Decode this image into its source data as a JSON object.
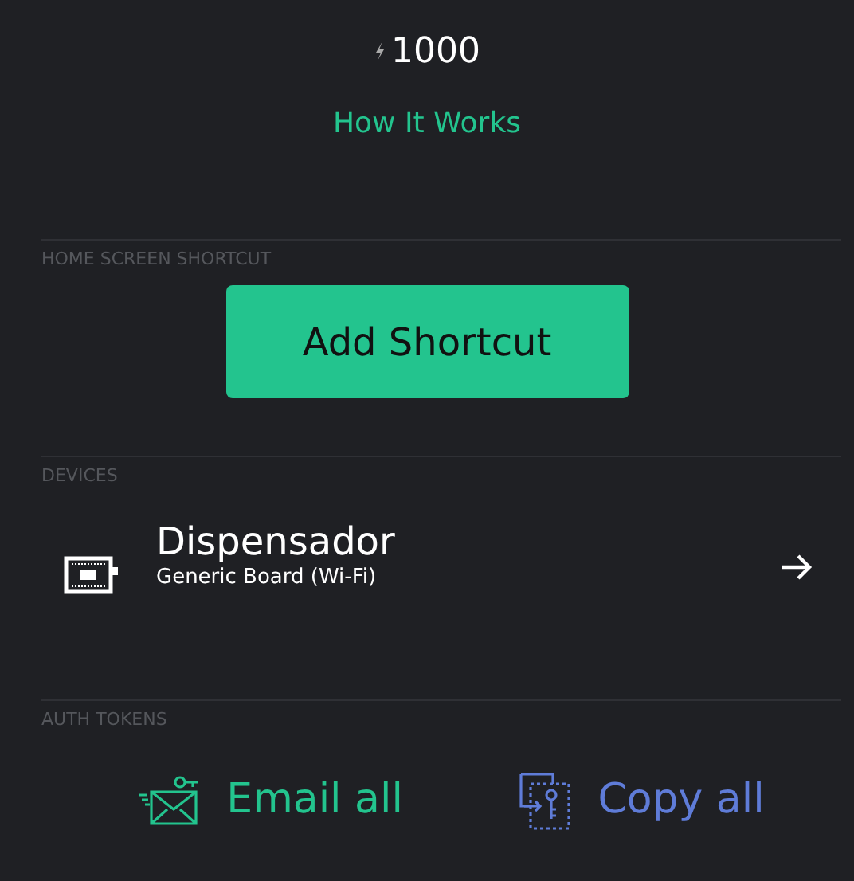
{
  "energy": {
    "amount": "1000"
  },
  "how_it_works": "How It Works",
  "sections": [
    {
      "kind": "shortcut",
      "heading": "HOME SCREEN SHORTCUT",
      "button": "Add Shortcut"
    },
    {
      "kind": "devices",
      "heading": "DEVICES",
      "device": {
        "name": "Dispensador",
        "board": "Generic Board (Wi-Fi)"
      }
    },
    {
      "kind": "tokens",
      "heading": "AUTH TOKENS",
      "actions": [
        "Email all",
        "Copy all"
      ]
    }
  ]
}
